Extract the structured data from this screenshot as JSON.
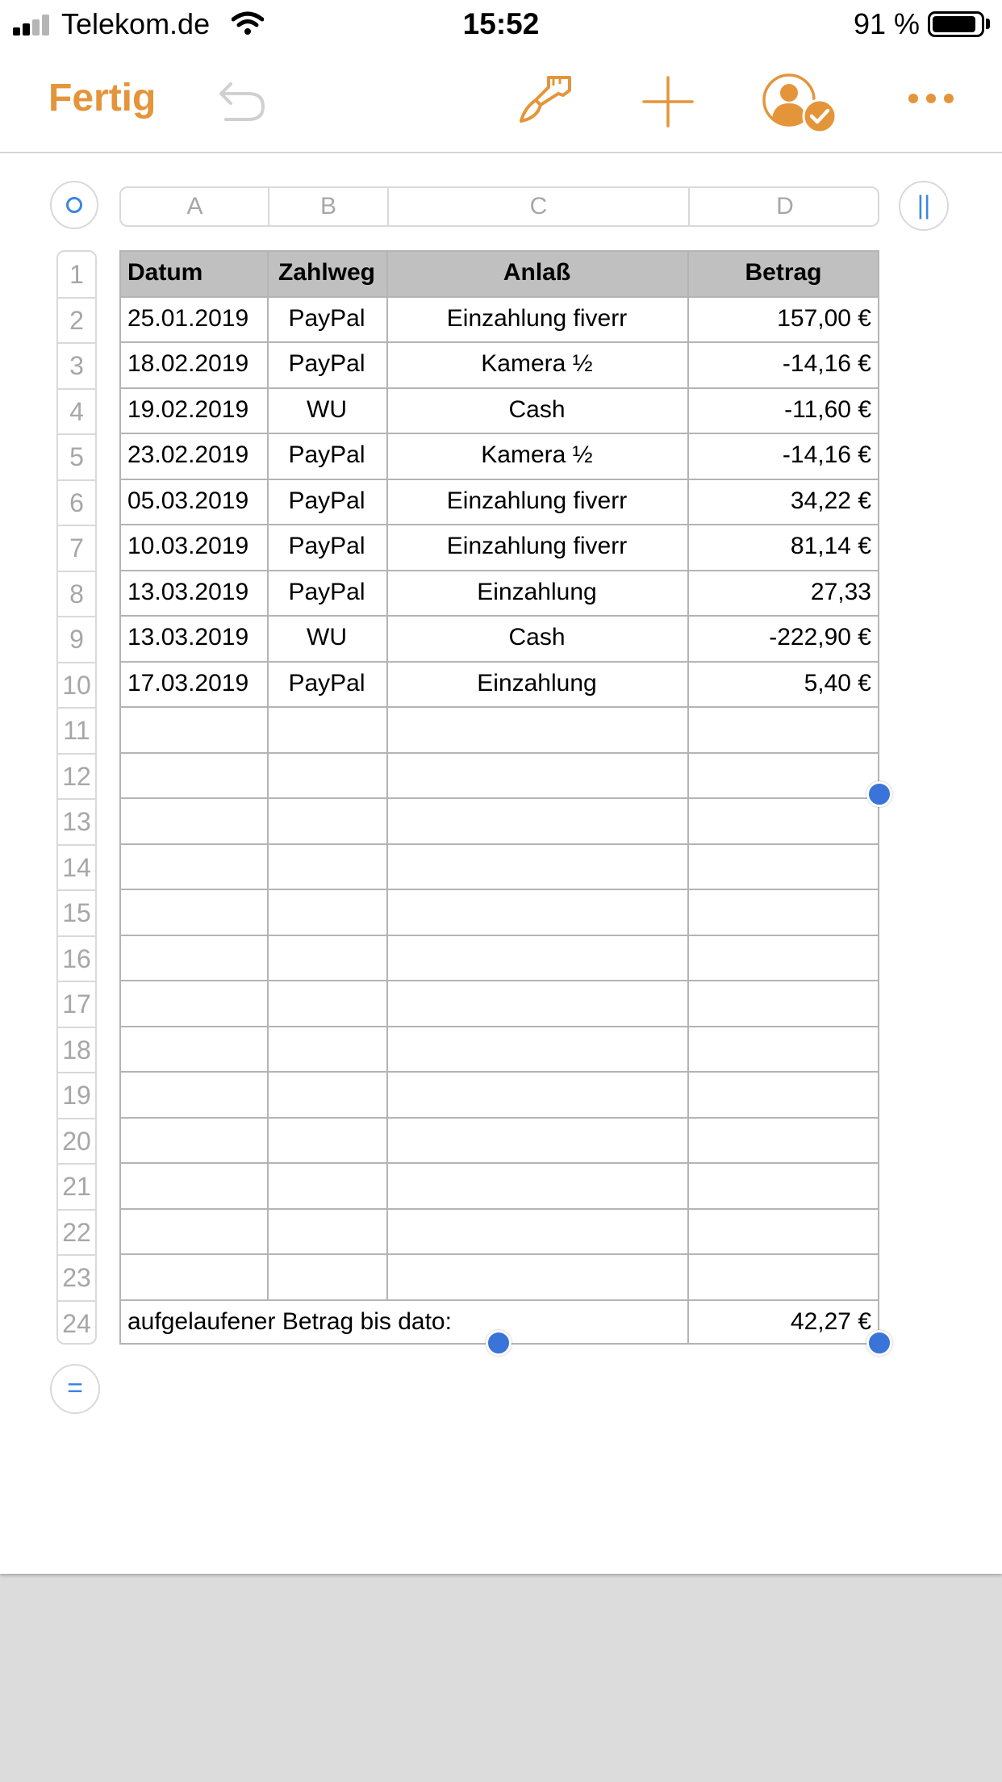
{
  "status_bar": {
    "carrier": "Telekom.de",
    "time": "15:52",
    "battery": "91 %",
    "battery_level": 0.91,
    "icons": [
      "signal-icon",
      "wifi-icon",
      "battery-icon"
    ]
  },
  "toolbar": {
    "done_label": "Fertig",
    "icons": [
      "undo-icon",
      "paintbrush-icon",
      "plus-icon",
      "collaboration-icon",
      "more-icon"
    ],
    "accent_color": "#e4953a"
  },
  "columns": [
    "A",
    "B",
    "C",
    "D"
  ],
  "rows": [
    "1",
    "2",
    "3",
    "4",
    "5",
    "6",
    "7",
    "8",
    "9",
    "10",
    "11",
    "12",
    "13",
    "14",
    "15",
    "16",
    "17",
    "18",
    "19",
    "20",
    "21",
    "22",
    "23",
    "24"
  ],
  "table": {
    "header": [
      "Datum",
      "Zahlweg",
      "Anlaß",
      "Betrag"
    ],
    "body": [
      [
        " 25.01.2019",
        "PayPal",
        "Einzahlung fiverr",
        "157,00 €"
      ],
      [
        "18.02.2019",
        "PayPal",
        "Kamera ½",
        "-14,16 €"
      ],
      [
        "19.02.2019",
        "WU",
        "Cash",
        "-11,60 €"
      ],
      [
        "23.02.2019",
        "PayPal",
        "Kamera ½",
        "-14,16 €"
      ],
      [
        "05.03.2019",
        "PayPal",
        "Einzahlung fiverr",
        "34,22 €"
      ],
      [
        "10.03.2019",
        "PayPal",
        "Einzahlung fiverr",
        "81,14 €"
      ],
      [
        "13.03.2019",
        "PayPal",
        "Einzahlung",
        "27,33"
      ],
      [
        "13.03.2019",
        "WU",
        "Cash",
        "-222,90 €"
      ],
      [
        "17.03.2019",
        "PayPal",
        "Einzahlung",
        "5,40 €"
      ],
      [
        "",
        "",
        "",
        ""
      ],
      [
        "",
        "",
        "",
        ""
      ],
      [
        "",
        "",
        "",
        ""
      ],
      [
        "",
        "",
        "",
        ""
      ],
      [
        "",
        "",
        "",
        ""
      ],
      [
        "",
        "",
        "",
        ""
      ],
      [
        "",
        "",
        "",
        ""
      ],
      [
        "",
        "",
        "",
        ""
      ],
      [
        "",
        "",
        "",
        ""
      ],
      [
        "",
        "",
        "",
        ""
      ],
      [
        "",
        "",
        "",
        ""
      ],
      [
        "",
        "",
        "",
        ""
      ],
      [
        "",
        "",
        "",
        ""
      ]
    ],
    "footer_label": "aufgelaufener Betrag bis dato:",
    "footer_value": "42,27 €",
    "header_bg": "#c0c0c0",
    "handle_color": "#3b74d8"
  }
}
